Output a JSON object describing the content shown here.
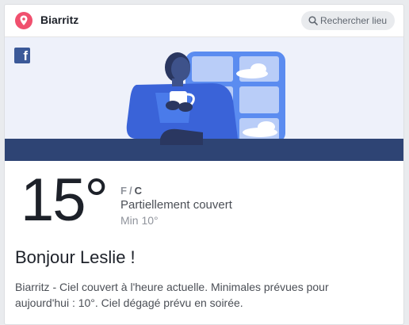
{
  "header": {
    "city": "Biarritz",
    "location_icon": "map-pin-icon",
    "search": {
      "placeholder": "Rechercher lieu",
      "icon": "search-icon"
    }
  },
  "banner": {
    "logo": "facebook-logo",
    "logo_glyph": "f",
    "illustration": "person-drinking-coffee-by-window-illustration"
  },
  "weather": {
    "temperature": "15°",
    "unit_f": "F",
    "unit_separator": "/",
    "unit_c": "C",
    "selected_unit": "C",
    "condition": "Partiellement couvert",
    "minimum": "Min 10°"
  },
  "greeting": "Bonjour Leslie !",
  "summary": "Biarritz - Ciel couvert à l'heure actuelle. Minimales prévues pour aujourd'hui : 10°. Ciel dégagé prévu en soirée.",
  "colors": {
    "pin": "#f0506e",
    "facebook_blue": "#3b5998",
    "illustration_blue": "#4a7bea",
    "ground_navy": "#2e4474",
    "banner_background": "#eef1fa"
  }
}
